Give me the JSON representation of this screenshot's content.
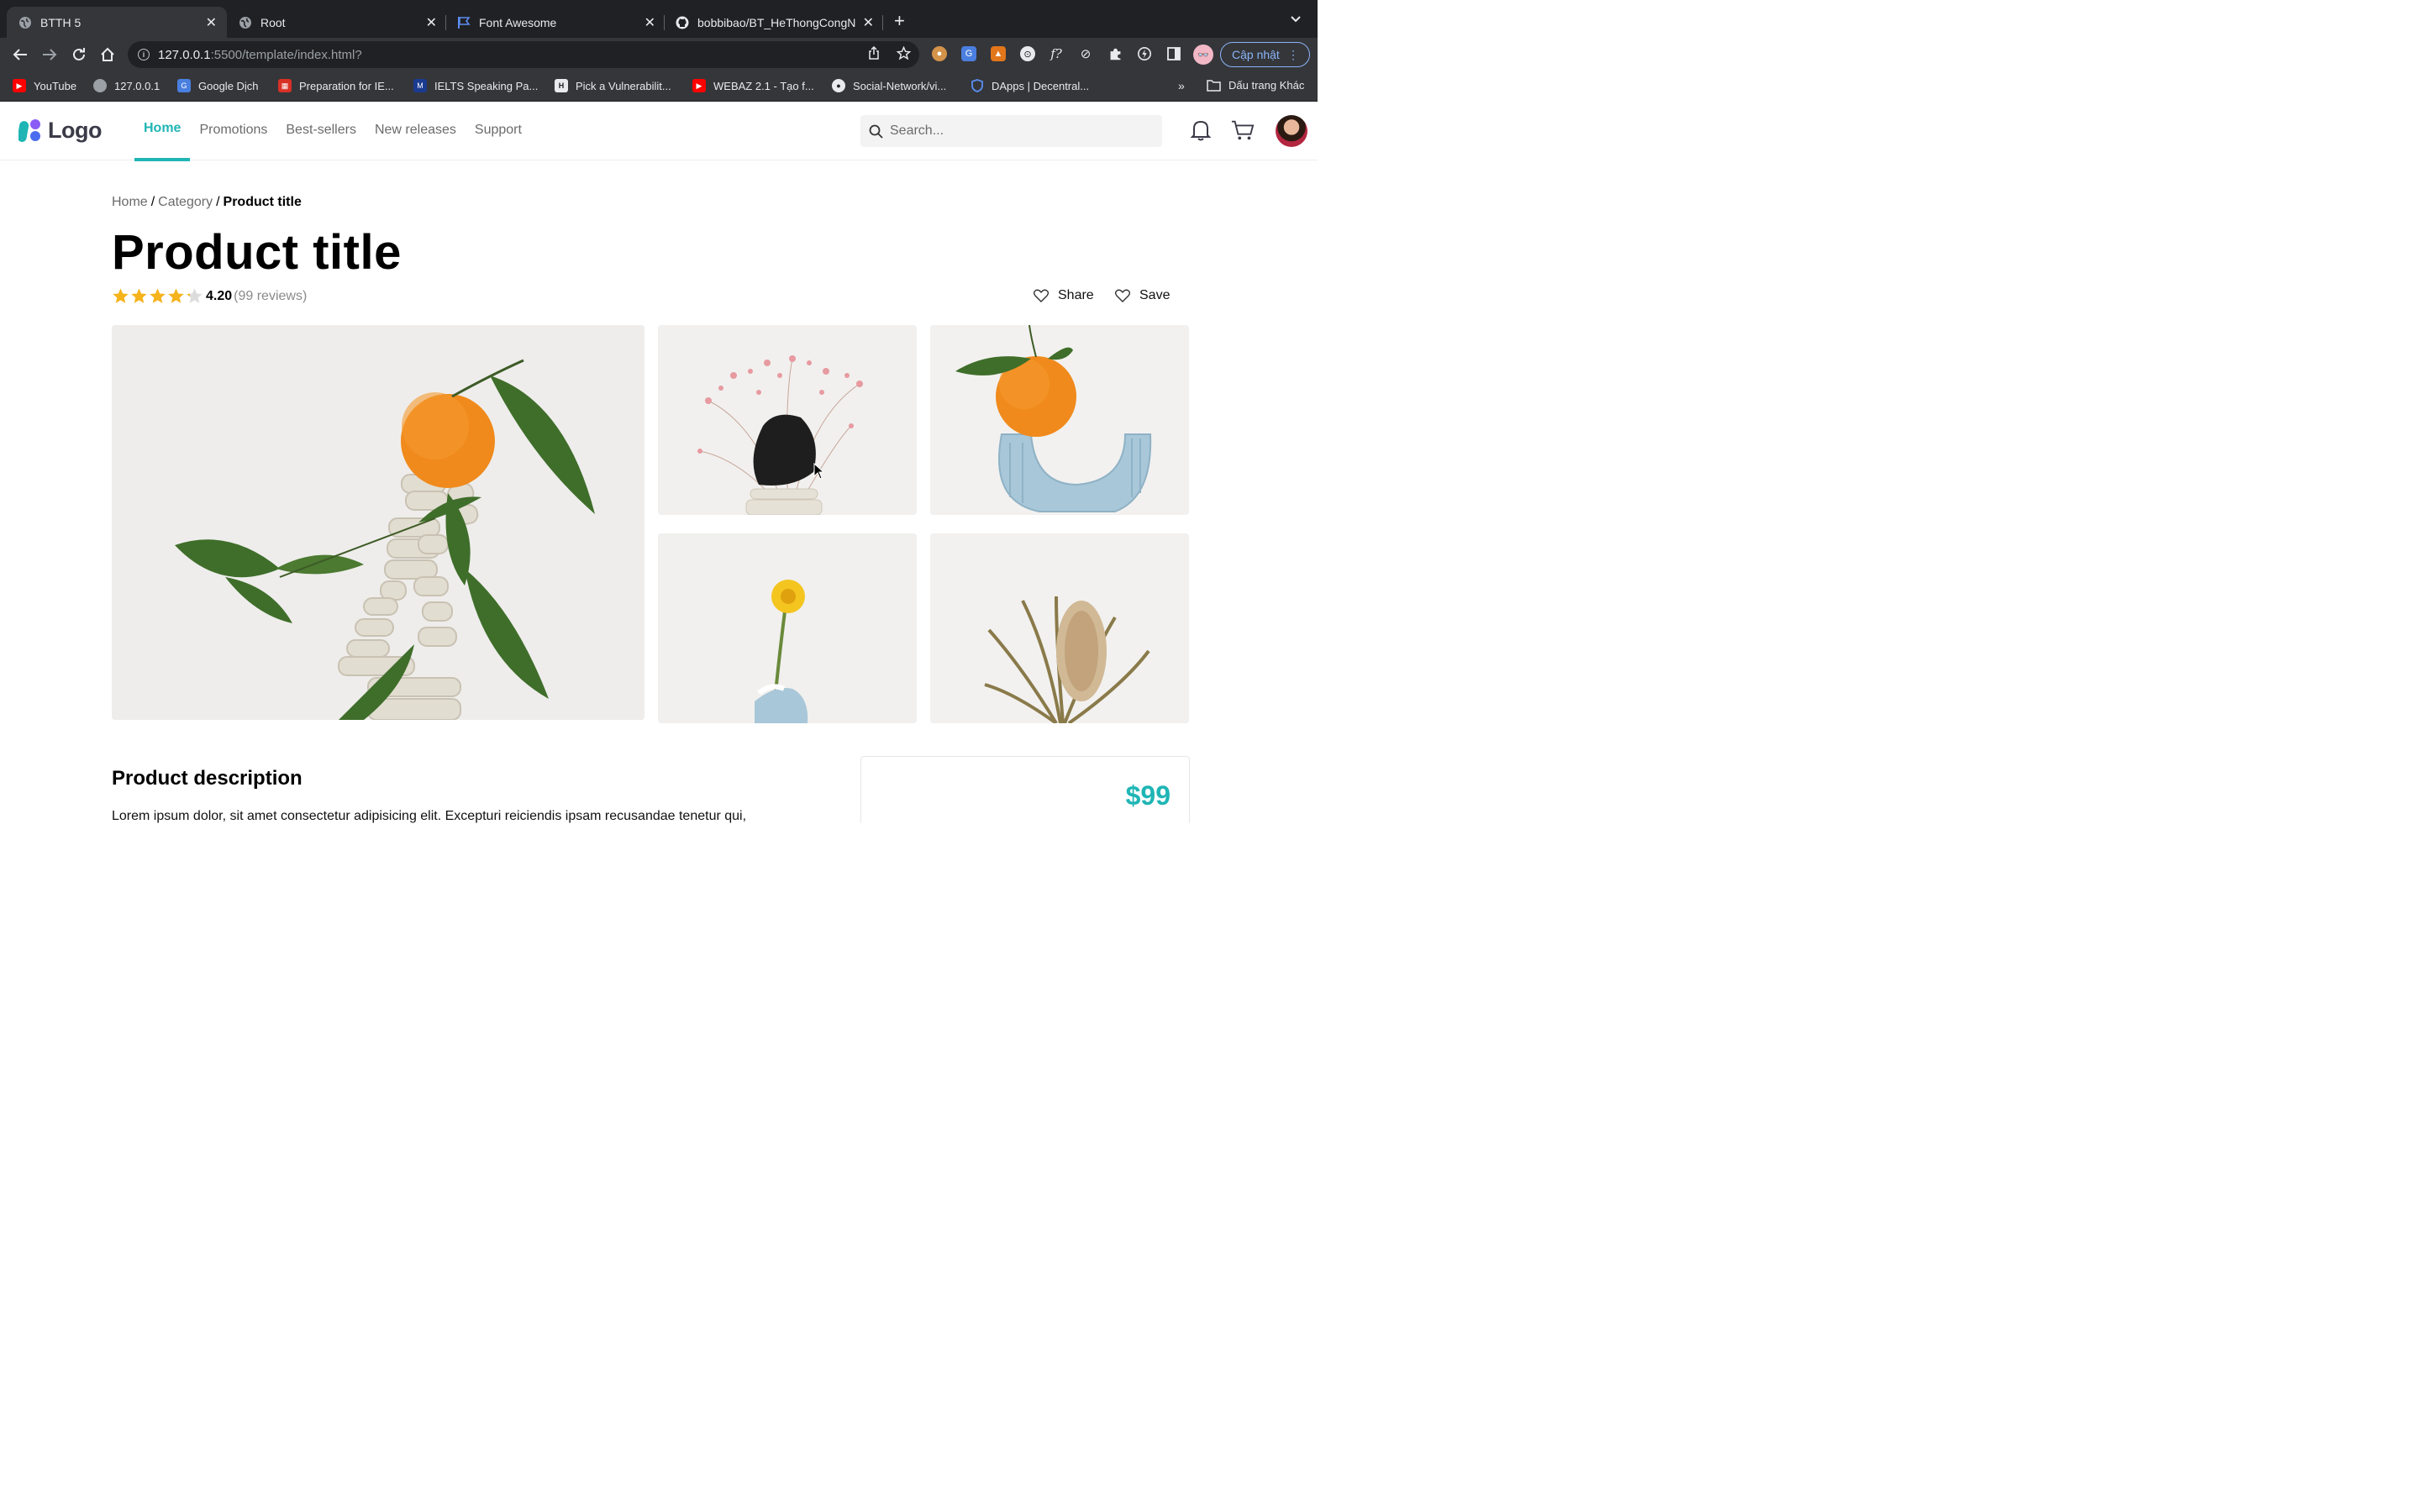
{
  "browser": {
    "tabs": [
      {
        "title": "BTTH 5",
        "active": true
      },
      {
        "title": "Root",
        "active": false
      },
      {
        "title": "Font Awesome",
        "active": false
      },
      {
        "title": "bobbibao/BT_HeThongCongNg",
        "active": false
      }
    ],
    "url_host": "127.0.0.1",
    "url_rest": ":5500/template/index.html?",
    "update_label": "Cập nhật",
    "bookmarks": [
      {
        "label": "YouTube"
      },
      {
        "label": "127.0.0.1"
      },
      {
        "label": "Google Dịch"
      },
      {
        "label": "Preparation for IE..."
      },
      {
        "label": "IELTS Speaking Pa..."
      },
      {
        "label": "Pick a Vulnerabilit..."
      },
      {
        "label": "WEBAZ 2.1 - Tạo f..."
      },
      {
        "label": "Social-Network/vi..."
      },
      {
        "label": "DApps | Decentral..."
      }
    ],
    "bookmarks_more": "»",
    "other_bookmarks": "Dấu trang Khác"
  },
  "site": {
    "logo_text": "Logo",
    "nav": [
      {
        "label": "Home",
        "active": true
      },
      {
        "label": "Promotions",
        "active": false
      },
      {
        "label": "Best-sellers",
        "active": false
      },
      {
        "label": "New releases",
        "active": false
      },
      {
        "label": "Support",
        "active": false
      }
    ],
    "search_placeholder": "Search...",
    "accent_color": "#1fb5b5"
  },
  "product": {
    "breadcrumb": {
      "home": "Home",
      "category": "Category",
      "current": "Product title",
      "separator": "/"
    },
    "title": "Product title",
    "rating_value": 4.2,
    "rating_text": "4.20",
    "reviews_text": "(99 reviews)",
    "share_label": "Share",
    "save_label": "Save",
    "description_heading": "Product description",
    "description_text": "Lorem ipsum dolor, sit amet consectetur adipisicing elit. Excepturi reiciendis ipsam recusandae tenetur qui,",
    "price": "$99"
  }
}
